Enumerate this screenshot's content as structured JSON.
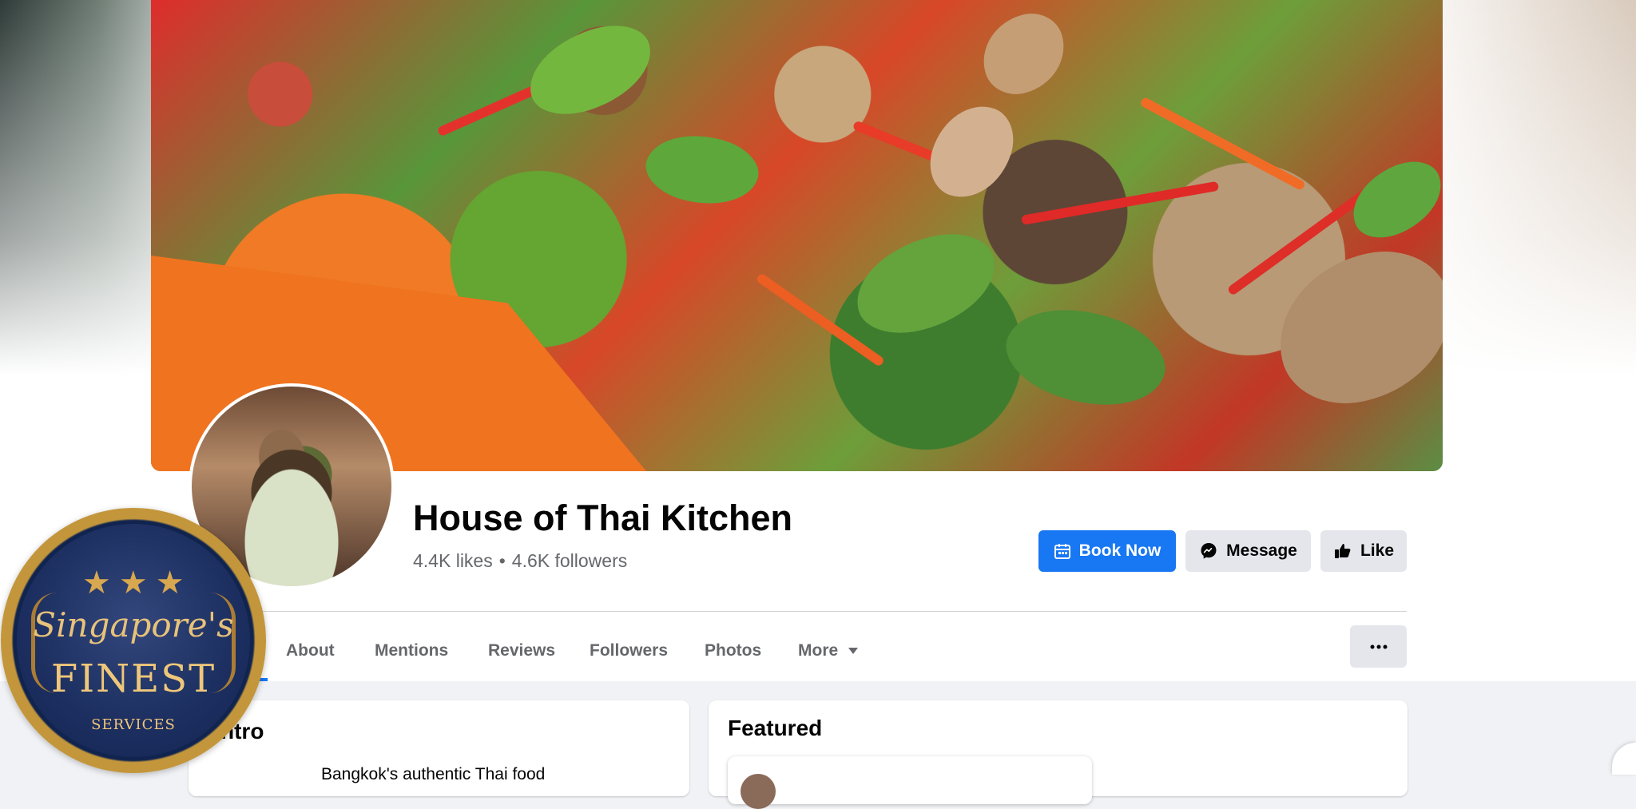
{
  "page": {
    "title": "House of Thai Kitchen",
    "likes": "4.4K likes",
    "separator": "•",
    "followers": "4.6K followers"
  },
  "actions": {
    "book_now": "Book Now",
    "message": "Message",
    "like": "Like",
    "more_options_icon": "more-horizontal-icon"
  },
  "tabs": {
    "about": "About",
    "mentions": "Mentions",
    "reviews": "Reviews",
    "followers": "Followers",
    "photos": "Photos",
    "more": "More"
  },
  "intro": {
    "title": "ntro",
    "text": "Bangkok's authentic Thai food"
  },
  "featured": {
    "title": "Featured"
  },
  "badge": {
    "stars": "★★★",
    "line1": "Singapore's",
    "line2": "FINEST",
    "line3": "SERVICES"
  },
  "colors": {
    "primary": "#1877f2",
    "background": "#f0f2f5",
    "button_gray": "#e4e6eb",
    "text_secondary": "#65676b"
  }
}
